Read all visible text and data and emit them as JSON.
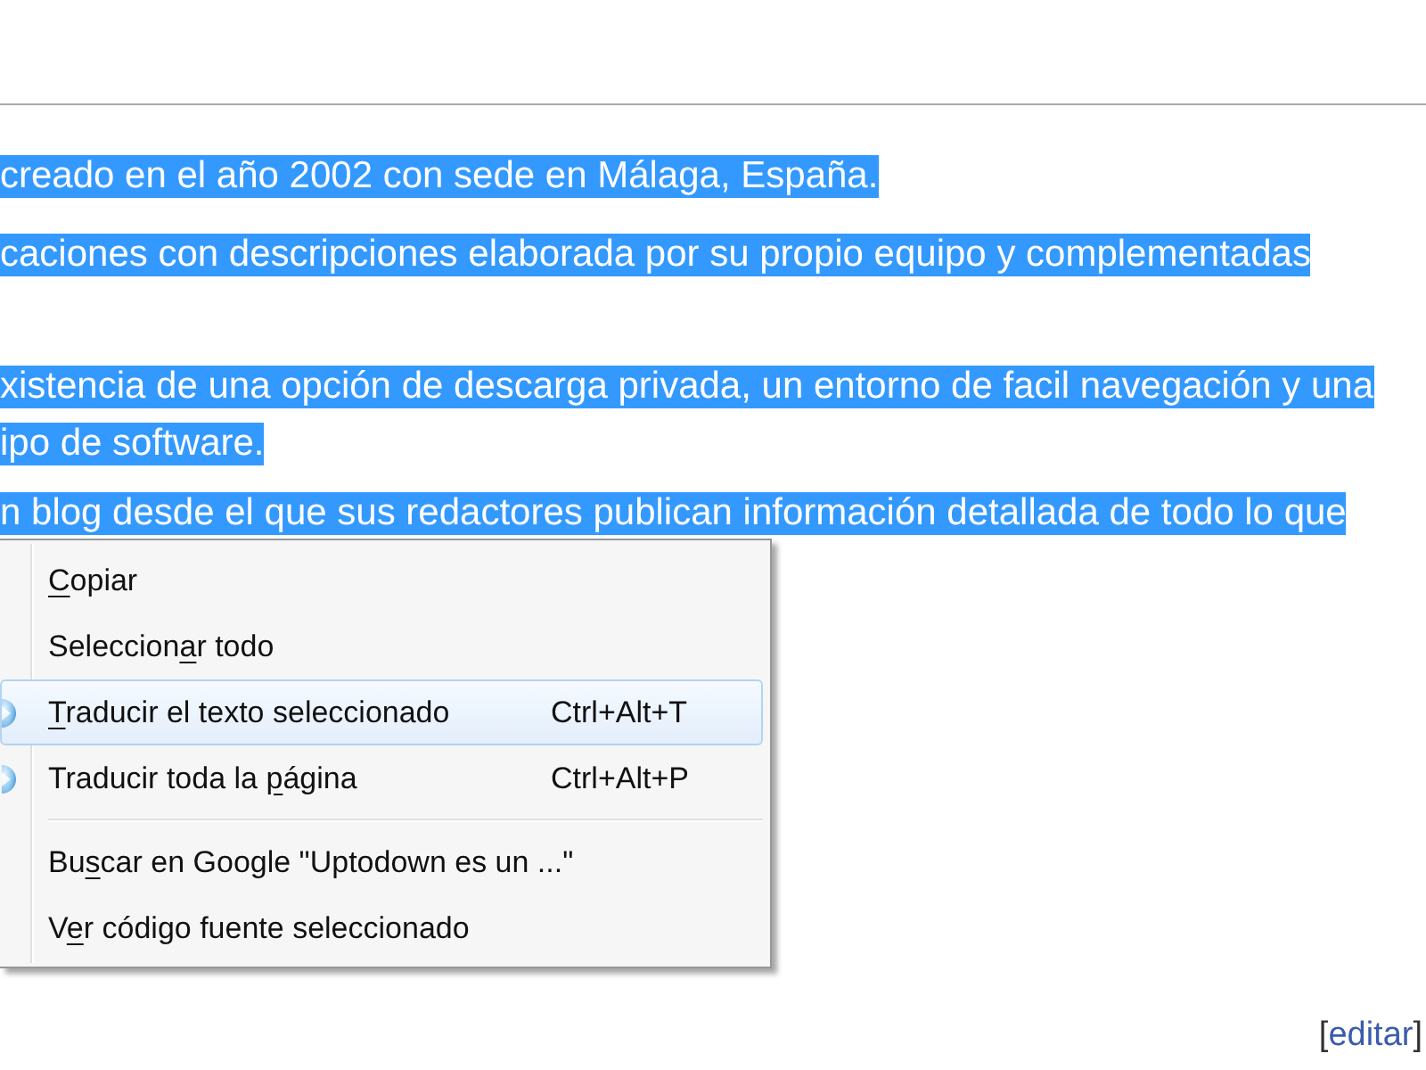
{
  "article": {
    "paragraphs": [
      {
        "lines": [
          {
            "text": "creado en el año 2002 con sede en Málaga, España.",
            "selected": true
          }
        ]
      },
      {
        "lines": [
          {
            "text": "caciones con descripciones elaborada por su propio equipo y complementadas",
            "selected": true
          }
        ]
      },
      {
        "lines": [
          {
            "text": "xistencia de una opción de descarga privada, un entorno de facil navegación y una",
            "selected": true
          },
          {
            "text": "ipo de software.",
            "selected": true
          }
        ]
      },
      {
        "lines": [
          {
            "text": "n blog desde el que sus redactores publican información detallada de todo lo que",
            "selected": true
          }
        ]
      }
    ]
  },
  "edit_link": {
    "before": "[",
    "label": "editar",
    "after": "]"
  },
  "context_menu": {
    "items": [
      {
        "kind": "item",
        "label": {
          "key": "C",
          "after": "opiar"
        },
        "selected": false,
        "has_icon": false
      },
      {
        "kind": "item",
        "label": {
          "before": "Seleccion",
          "key": "a",
          "after": "r todo"
        },
        "selected": false,
        "has_icon": false
      },
      {
        "kind": "item",
        "label": {
          "key": "T",
          "after": "raducir el texto seleccionado"
        },
        "shortcut": "Ctrl+Alt+T",
        "selected": true,
        "has_icon": true
      },
      {
        "kind": "item",
        "label": {
          "before": "Traducir toda la ",
          "key": "p",
          "after": "ágina"
        },
        "shortcut": "Ctrl+Alt+P",
        "selected": false,
        "has_icon": true
      },
      {
        "kind": "separator"
      },
      {
        "kind": "item",
        "label": {
          "before": "Bu",
          "key": "s",
          "after": "car en Google \"Uptodown es un ...\""
        },
        "selected": false,
        "has_icon": false
      },
      {
        "kind": "item",
        "label": {
          "before": "V",
          "key": "e",
          "after": "r código fuente seleccionado"
        },
        "selected": false,
        "has_icon": false
      }
    ]
  }
}
